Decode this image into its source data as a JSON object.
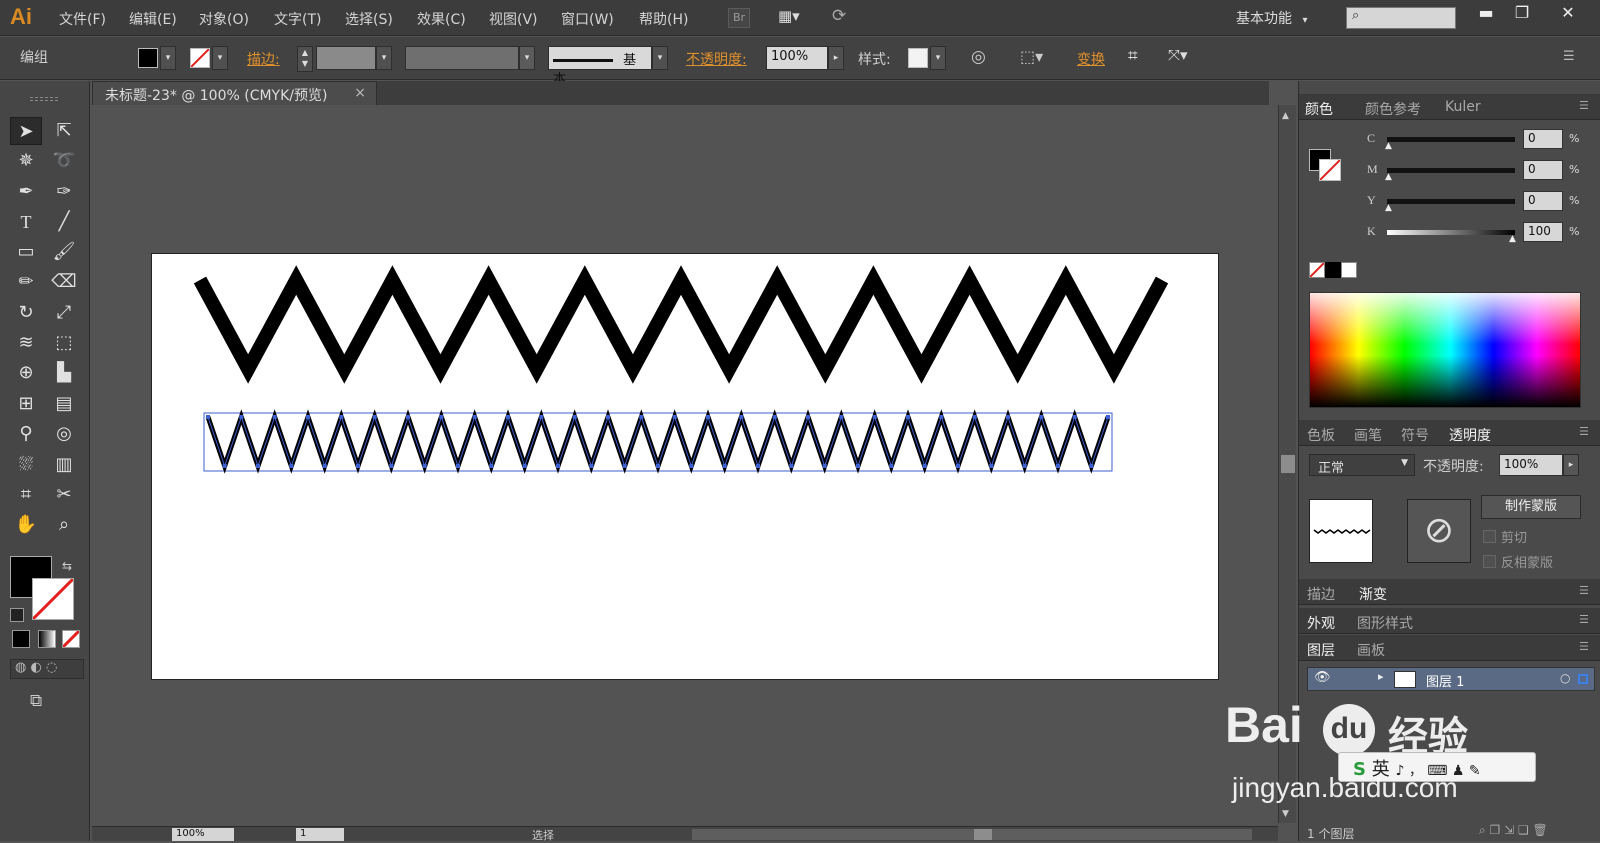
{
  "app": {
    "logo": "Ai"
  },
  "menu": [
    "文件(F)",
    "编辑(E)",
    "对象(O)",
    "文字(T)",
    "选择(S)",
    "效果(C)",
    "视图(V)",
    "窗口(W)",
    "帮助(H)"
  ],
  "menubar": {
    "bridge_label": "Br",
    "workspace": "基本功能",
    "workspace_arrow": "▾"
  },
  "window_controls": {
    "minimize": "▬",
    "restore": "❐",
    "close": "✕"
  },
  "controlbar": {
    "selection_label": "编组",
    "stroke_label": "描边",
    "stroke_colon": ":",
    "profile_label": "基本",
    "opacity_label": "不透明度",
    "opacity_colon": ":",
    "opacity_value": "100%",
    "style_label": "样式",
    "style_colon": ":",
    "transform_label": "变换"
  },
  "document": {
    "tab_title": "未标题-23* @ 100% (CMYK/预览)",
    "close": "×"
  },
  "panels": {
    "color": {
      "tabs": [
        "颜色",
        "颜色参考",
        "Kuler"
      ],
      "channels": [
        {
          "name": "C",
          "value": "0",
          "level": 0
        },
        {
          "name": "M",
          "value": "0",
          "level": 0
        },
        {
          "name": "Y",
          "value": "0",
          "level": 0
        },
        {
          "name": "K",
          "value": "100",
          "level": 1
        }
      ],
      "percent": "%"
    },
    "swatch_tabs": [
      "色板",
      "画笔",
      "符号",
      "透明度"
    ],
    "transparency": {
      "mode": "正常",
      "opacity_label": "不透明度",
      "opacity_colon": ":",
      "opacity_value": "100%",
      "make_mask": "制作蒙版",
      "clip_label": "剪切",
      "invert_label": "反相蒙版"
    },
    "stroke_tabs": [
      "描边",
      "渐变"
    ],
    "appearance_tabs": [
      "外观",
      "图形样式"
    ],
    "layers_tabs": [
      "图层",
      "画板"
    ],
    "layer_name": "图层 1",
    "layers_footer": "1 个图层"
  },
  "statusbar": {
    "zoom": "100%",
    "page": "1",
    "mode": "选择"
  },
  "watermark": {
    "brand": "Bai",
    "du": "du",
    "jy": "经验",
    "url": "jingyan.baidu.com",
    "ime": "英"
  },
  "colors": {
    "orange": "#e0902a",
    "selection_blue": "#3d5fd0",
    "ui_dark": "#3c3c3c"
  }
}
